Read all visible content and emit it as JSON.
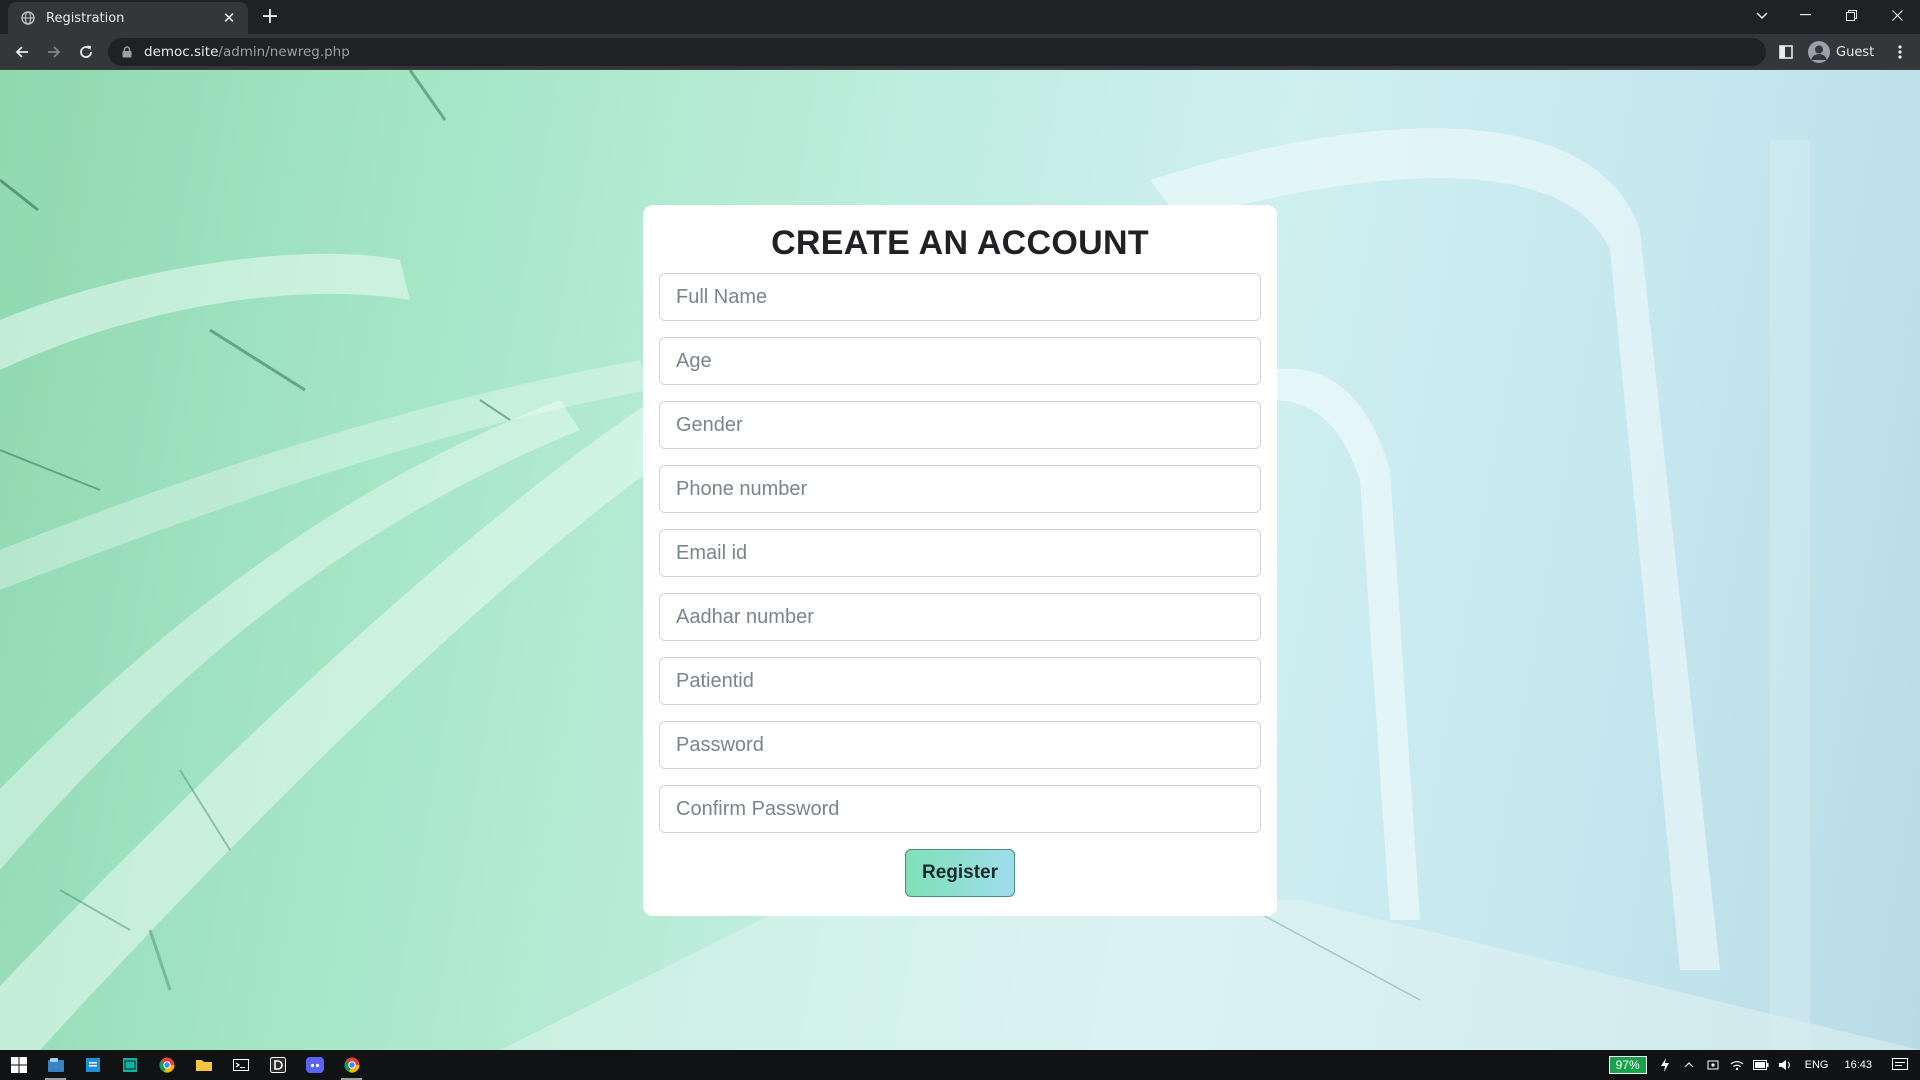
{
  "browser": {
    "tab_title": "Registration",
    "url_host": "democ.site",
    "url_path": "/admin/newreg.php",
    "profile_label": "Guest"
  },
  "page": {
    "heading": "CREATE AN ACCOUNT",
    "fields": {
      "full_name": "Full Name",
      "age": "Age",
      "gender": "Gender",
      "phone": "Phone number",
      "email": "Email id",
      "aadhar": "Aadhar number",
      "patientid": "Patientid",
      "password": "Password",
      "confirm_password": "Confirm Password"
    },
    "register_label": "Register"
  },
  "taskbar": {
    "battery_percent": "97%",
    "language": "ENG",
    "time": "16:43",
    "icons": [
      "windows-start-icon",
      "file-explorer-icon",
      "notes-icon",
      "sheets-icon",
      "chrome-icon",
      "folder-icon",
      "terminal-icon",
      "d-app-icon",
      "discord-icon",
      "chrome-active-icon"
    ]
  },
  "colors": {
    "accent_green": "#7fe0b8",
    "accent_blue": "#9fdceb",
    "battery_green": "#16a34a"
  }
}
